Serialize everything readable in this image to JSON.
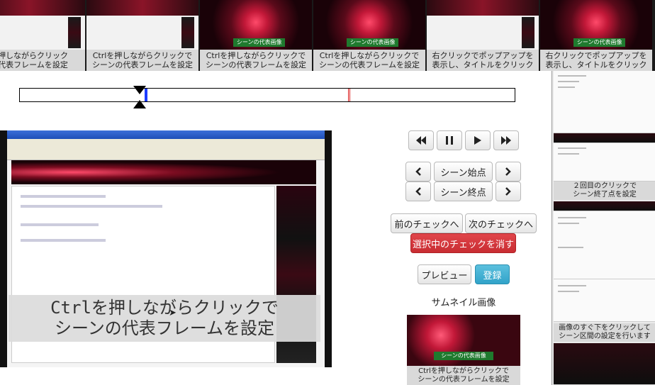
{
  "filmstrip": {
    "frames": [
      {
        "caption": "を押しながらクリック\nの代表フレームを設定",
        "style": "light"
      },
      {
        "caption": "Ctrlを押しながらクリックで\nシーンの代表フレームを設定",
        "style": "light"
      },
      {
        "caption": "Ctrlを押しながらクリックで\nシーンの代表フレームを設定",
        "style": "dark",
        "banner": "シーンの代表画像"
      },
      {
        "caption": "Ctrlを押しながらクリックで\nシーンの代表フレームを設定",
        "style": "dark",
        "banner": "シーンの代表画像"
      },
      {
        "caption": "右クリックでポップアップを\n表示し、タイトルをクリック",
        "style": "light"
      },
      {
        "caption": "右クリックでポップアップを\n表示し、タイトルをクリック",
        "style": "dark",
        "banner": "シーンの代表画像"
      }
    ]
  },
  "timeline": {
    "range_start_fraction": 0.252,
    "marker_fraction": 0.662
  },
  "video": {
    "caption": "Ctrlを押しながらクリックで\nシーンの代表フレームを設定"
  },
  "controls": {
    "scene_start_label": "シーン始点",
    "scene_end_label": "シーン終点",
    "prev_check_label": "前のチェックへ",
    "next_check_label": "次のチェックへ",
    "delete_check_label": "選択中のチェックを消す",
    "preview_label": "プレビュー",
    "register_label": "登録",
    "colors": {
      "danger": "#c92d32",
      "primary": "#31a3c9"
    }
  },
  "thumbnail": {
    "label": "サムネイル画像",
    "banner": "シーンの代表画像",
    "caption": "Ctrlを押しながらクリックで\nシーンの代表フレームを設定"
  },
  "scenelist": {
    "captions": [
      "２回目のクリックで\nシーン終了点を設定",
      "画像のすぐ下をクリックして\nシーン区間の設定を行います"
    ]
  }
}
